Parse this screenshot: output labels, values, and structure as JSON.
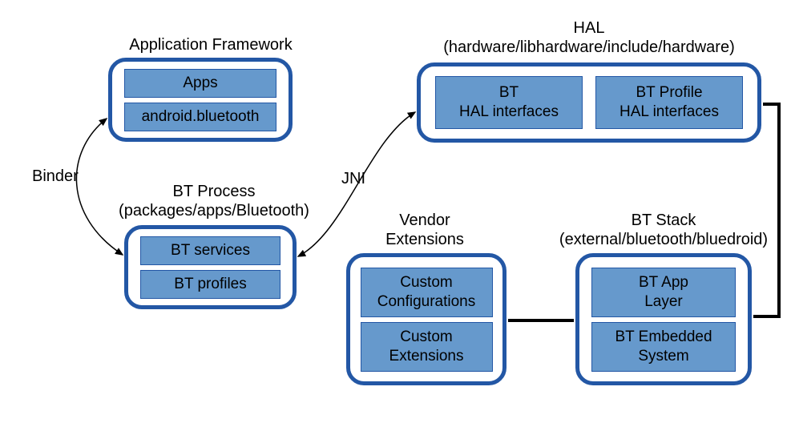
{
  "diagram": {
    "appFramework": {
      "title": "Application Framework",
      "cell1": "Apps",
      "cell2": "android.bluetooth"
    },
    "btProcess": {
      "title_line1": "BT Process",
      "title_line2": "(packages/apps/Bluetooth)",
      "cell1": "BT services",
      "cell2": "BT profiles"
    },
    "hal": {
      "title_line1": "HAL",
      "title_line2": "(hardware/libhardware/include/hardware)",
      "cell1_line1": "BT",
      "cell1_line2": "HAL interfaces",
      "cell2_line1": "BT Profile",
      "cell2_line2": "HAL interfaces"
    },
    "vendor": {
      "title_line1": "Vendor",
      "title_line2": "Extensions",
      "cell1_line1": "Custom",
      "cell1_line2": "Configurations",
      "cell2_line1": "Custom",
      "cell2_line2": "Extensions"
    },
    "btStack": {
      "title_line1": "BT Stack",
      "title_line2": "(external/bluetooth/bluedroid)",
      "cell1_line1": "BT App",
      "cell1_line2": "Layer",
      "cell2_line1": "BT Embedded",
      "cell2_line2": "System"
    },
    "edges": {
      "binder": "Binder",
      "jni": "JNI"
    }
  }
}
